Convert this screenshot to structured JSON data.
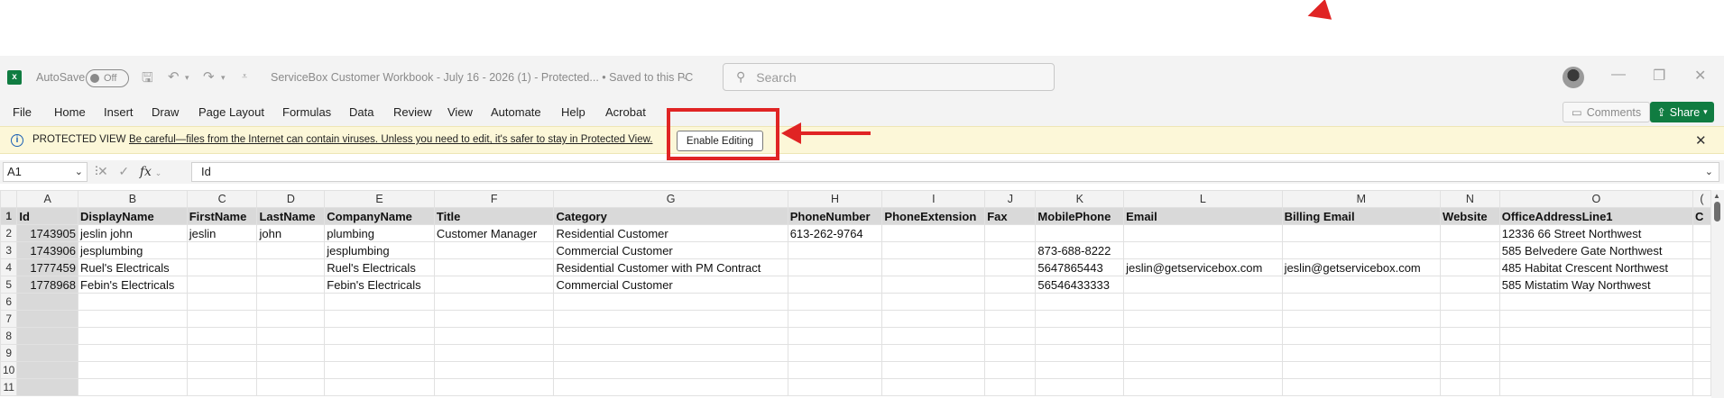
{
  "titlebar": {
    "app_icon": "excel-icon",
    "autosave_label": "AutoSave",
    "autosave_state": "Off",
    "doc_title": "ServiceBox Customer Workbook - July 16 - 2026 (1)  -  Protected...   •  Saved to this PC",
    "search_placeholder": "Search"
  },
  "menu": {
    "items": [
      "File",
      "Home",
      "Insert",
      "Draw",
      "Page Layout",
      "Formulas",
      "Data",
      "Review",
      "View",
      "Automate",
      "Help",
      "Acrobat"
    ],
    "comments_label": "Comments",
    "share_label": "Share"
  },
  "protected_view": {
    "label": "PROTECTED VIEW",
    "message": "Be careful—files from the Internet can contain viruses. Unless you need to edit, it's safer to stay in Protected View.",
    "button": "Enable Editing"
  },
  "formula_bar": {
    "cell_ref": "A1",
    "fx": "fx",
    "value": "Id"
  },
  "grid": {
    "columns": [
      "A",
      "B",
      "C",
      "D",
      "E",
      "F",
      "G",
      "H",
      "I",
      "J",
      "K",
      "L",
      "M",
      "N",
      "O",
      "("
    ],
    "row_numbers": [
      "1",
      "2",
      "3",
      "4",
      "5",
      "6",
      "7",
      "8",
      "9",
      "10",
      "11"
    ],
    "rows": [
      [
        "Id",
        "DisplayName",
        "FirstName",
        "LastName",
        "CompanyName",
        "Title",
        "Category",
        "PhoneNumber",
        "PhoneExtension",
        "Fax",
        "MobilePhone",
        "Email",
        "Billing Email",
        "Website",
        "OfficeAddressLine1",
        "C"
      ],
      [
        "1743905",
        "jeslin john",
        "jeslin",
        "john",
        "plumbing",
        "Customer Manager",
        "Residential Customer",
        "613-262-9764",
        "",
        "",
        "",
        "",
        "",
        "",
        "12336 66 Street Northwest",
        ""
      ],
      [
        "1743906",
        "jesplumbing",
        "",
        "",
        "jesplumbing",
        "",
        "Commercial Customer",
        "",
        "",
        "",
        "873-688-8222",
        "",
        "",
        "",
        "585 Belvedere Gate Northwest",
        ""
      ],
      [
        "1777459",
        "Ruel's Electricals",
        "",
        "",
        "Ruel's Electricals",
        "",
        "Residential Customer with PM Contract",
        "",
        "",
        "",
        "5647865443",
        "jeslin@getservicebox.com",
        "jeslin@getservicebox.com",
        "",
        "485 Habitat Crescent Northwest",
        ""
      ],
      [
        "1778968",
        "Febin's Electricals",
        "",
        "",
        "Febin's Electricals",
        "",
        "Commercial Customer",
        "",
        "",
        "",
        "56546433333",
        "",
        "",
        "",
        "585 Mistatim Way Northwest",
        ""
      ],
      [
        "",
        "",
        "",
        "",
        "",
        "",
        "",
        "",
        "",
        "",
        "",
        "",
        "",
        "",
        "",
        ""
      ],
      [
        "",
        "",
        "",
        "",
        "",
        "",
        "",
        "",
        "",
        "",
        "",
        "",
        "",
        "",
        "",
        ""
      ],
      [
        "",
        "",
        "",
        "",
        "",
        "",
        "",
        "",
        "",
        "",
        "",
        "",
        "",
        "",
        "",
        ""
      ],
      [
        "",
        "",
        "",
        "",
        "",
        "",
        "",
        "",
        "",
        "",
        "",
        "",
        "",
        "",
        "",
        ""
      ],
      [
        "",
        "",
        "",
        "",
        "",
        "",
        "",
        "",
        "",
        "",
        "",
        "",
        "",
        "",
        "",
        ""
      ],
      [
        "",
        "",
        "",
        "",
        "",
        "",
        "",
        "",
        "",
        "",
        "",
        "",
        "",
        "",
        "",
        ""
      ]
    ]
  },
  "colors": {
    "excel_green": "#107c41",
    "annotation_red": "#e02424",
    "protected_bar": "#fcf7d8"
  }
}
